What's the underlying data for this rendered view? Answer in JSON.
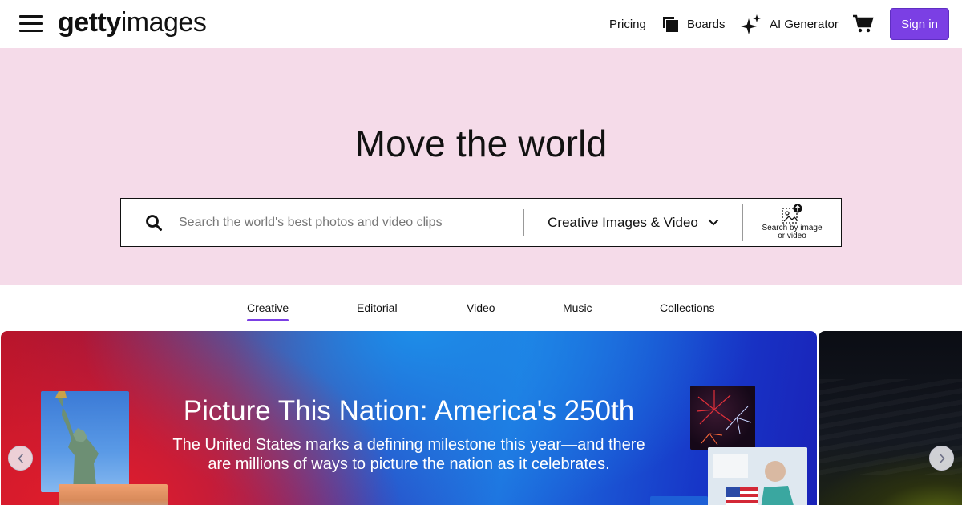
{
  "header": {
    "logo_bold": "getty",
    "logo_light": "images",
    "nav": {
      "pricing": "Pricing",
      "boards": "Boards",
      "ai_generator": "AI Generator"
    },
    "sign_in": "Sign in",
    "icons": [
      "menu-icon",
      "boards-icon",
      "sparkle-icon",
      "cart-icon"
    ]
  },
  "hero": {
    "title": "Move the world",
    "search": {
      "placeholder": "Search the world's best photos and video clips",
      "value": "",
      "type_selected": "Creative Images & Video",
      "image_search_line1": "Search by image",
      "image_search_line2": "or video"
    },
    "background_color": "#f5dbe9"
  },
  "tabs": [
    {
      "label": "Creative",
      "active": true
    },
    {
      "label": "Editorial",
      "active": false
    },
    {
      "label": "Video",
      "active": false
    },
    {
      "label": "Music",
      "active": false
    },
    {
      "label": "Collections",
      "active": false
    }
  ],
  "carousel": {
    "slide_title": "Picture This Nation: America's 250th",
    "slide_subtitle": "The United States marks a defining milestone this year—and there are millions of ways to picture the nation as it celebrates."
  },
  "colors": {
    "accent": "#7b3fe4"
  }
}
